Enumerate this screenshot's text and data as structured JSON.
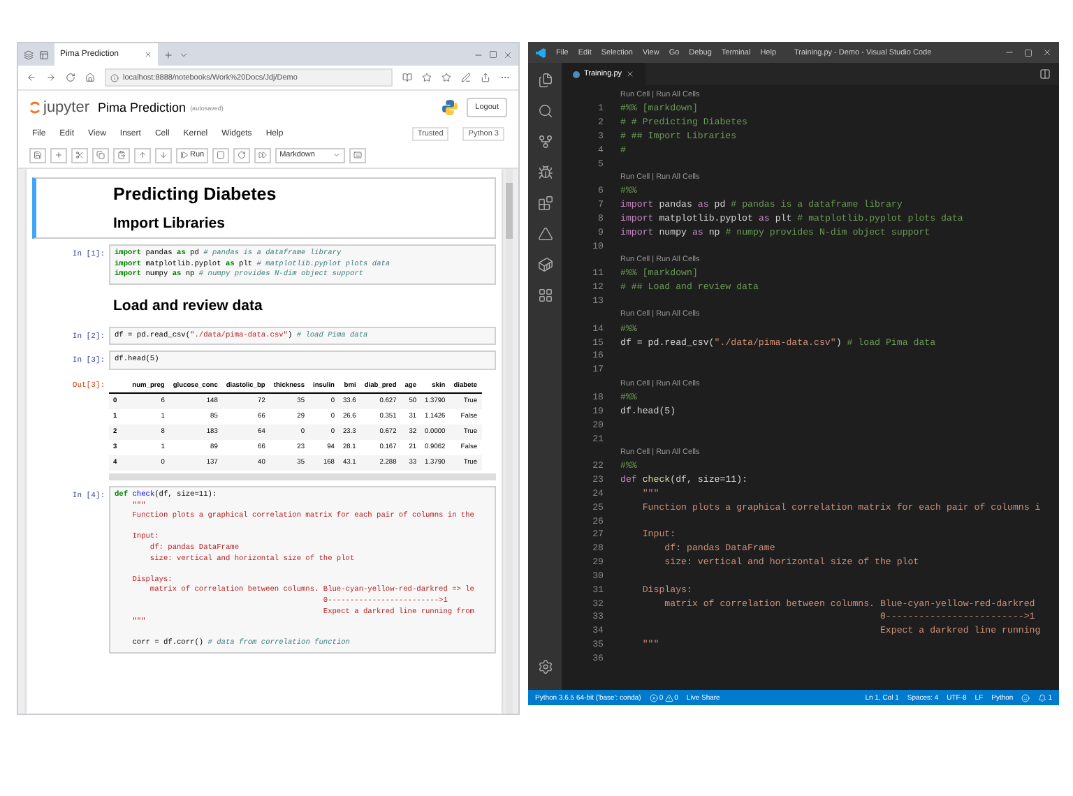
{
  "browser": {
    "tab_title": "Pima Prediction",
    "url": "localhost:8888/notebooks/Work%20Docs/Jdj/Demo"
  },
  "jupyter": {
    "logo_text": "jupyter",
    "notebook_title": "Pima Prediction",
    "save_status": "(autosaved)",
    "logout": "Logout",
    "menu": [
      "File",
      "Edit",
      "View",
      "Insert",
      "Cell",
      "Kernel",
      "Widgets",
      "Help"
    ],
    "trusted": "Trusted",
    "kernel": "Python 3",
    "run_label": "Run",
    "cell_type": "Markdown",
    "cells": [
      {
        "kind": "markdown",
        "selected": true,
        "blocks": [
          {
            "kind": "title",
            "text": "Predicting Diabetes"
          },
          {
            "kind": "heading",
            "text": "Import Libraries"
          }
        ]
      },
      {
        "kind": "code",
        "prompt": "In [1]:",
        "lines": [
          {
            "kind": "code",
            "segments": [
              {
                "kind": "kw",
                "text": "import"
              },
              {
                "kind": "plain",
                "text": " pandas "
              },
              {
                "kind": "kw",
                "text": "as"
              },
              {
                "kind": "plain",
                "text": " pd "
              },
              {
                "kind": "comment",
                "text": "# pandas is a dataframe library"
              }
            ]
          },
          {
            "kind": "code",
            "segments": [
              {
                "kind": "kw",
                "text": "import"
              },
              {
                "kind": "plain",
                "text": " matplotlib.pyplot "
              },
              {
                "kind": "kw",
                "text": "as"
              },
              {
                "kind": "plain",
                "text": " plt "
              },
              {
                "kind": "comment",
                "text": "# matplotlib.pyplot plots data"
              }
            ]
          },
          {
            "kind": "code",
            "segments": [
              {
                "kind": "kw",
                "text": "import"
              },
              {
                "kind": "plain",
                "text": " numpy "
              },
              {
                "kind": "kw",
                "text": "as"
              },
              {
                "kind": "plain",
                "text": " np "
              },
              {
                "kind": "comment",
                "text": "# numpy provides N-dim object support"
              }
            ]
          }
        ]
      },
      {
        "kind": "markdown",
        "selected": false,
        "blocks": [
          {
            "kind": "heading",
            "text": "Load and review data"
          }
        ]
      },
      {
        "kind": "code",
        "prompt": "In [2]:",
        "lines": [
          {
            "kind": "code",
            "segments": [
              {
                "kind": "plain",
                "text": "df = pd.read_csv("
              },
              {
                "kind": "str",
                "text": "\"./data/pima-data.csv\""
              },
              {
                "kind": "plain",
                "text": ") "
              },
              {
                "kind": "comment",
                "text": "# load Pima data"
              }
            ]
          }
        ]
      },
      {
        "kind": "code",
        "prompt": "In [3]:",
        "lines": [
          {
            "kind": "code",
            "segments": [
              {
                "kind": "plain",
                "text": "df.head(5)"
              }
            ]
          }
        ]
      },
      {
        "kind": "output",
        "prompt": "Out[3]:",
        "table": {
          "columns": [
            "",
            "num_preg",
            "glucose_conc",
            "diastolic_bp",
            "thickness",
            "insulin",
            "bmi",
            "diab_pred",
            "age",
            "skin",
            "diabete"
          ],
          "rows": [
            [
              "0",
              "6",
              "148",
              "72",
              "35",
              "0",
              "33.6",
              "0.627",
              "50",
              "1.3790",
              "True"
            ],
            [
              "1",
              "1",
              "85",
              "66",
              "29",
              "0",
              "26.6",
              "0.351",
              "31",
              "1.1426",
              "False"
            ],
            [
              "2",
              "8",
              "183",
              "64",
              "0",
              "0",
              "23.3",
              "0.672",
              "32",
              "0.0000",
              "True"
            ],
            [
              "3",
              "1",
              "89",
              "66",
              "23",
              "94",
              "28.1",
              "0.167",
              "21",
              "0.9062",
              "False"
            ],
            [
              "4",
              "0",
              "137",
              "40",
              "35",
              "168",
              "43.1",
              "2.288",
              "33",
              "1.3790",
              "True"
            ]
          ]
        }
      },
      {
        "kind": "code",
        "prompt": "In [4]:",
        "lines": [
          {
            "kind": "code",
            "segments": [
              {
                "kind": "kw",
                "text": "def"
              },
              {
                "kind": "fn",
                "text": " check"
              },
              {
                "kind": "plain",
                "text": "(df, size=11):"
              }
            ]
          },
          {
            "kind": "code",
            "segments": [
              {
                "kind": "str",
                "text": "    \"\"\""
              }
            ]
          },
          {
            "kind": "code",
            "segments": [
              {
                "kind": "str",
                "text": "    Function plots a graphical correlation matrix for each pair of columns in the"
              }
            ]
          },
          {
            "kind": "blank"
          },
          {
            "kind": "code",
            "segments": [
              {
                "kind": "str",
                "text": "    Input:"
              }
            ]
          },
          {
            "kind": "code",
            "segments": [
              {
                "kind": "str",
                "text": "        df: pandas DataFrame"
              }
            ]
          },
          {
            "kind": "code",
            "segments": [
              {
                "kind": "str",
                "text": "        size: vertical and horizontal size of the plot"
              }
            ]
          },
          {
            "kind": "blank"
          },
          {
            "kind": "code",
            "segments": [
              {
                "kind": "str",
                "text": "    Displays:"
              }
            ]
          },
          {
            "kind": "code",
            "segments": [
              {
                "kind": "str",
                "text": "        matrix of correlation between columns. Blue-cyan-yellow-red-darkred => le"
              }
            ]
          },
          {
            "kind": "code",
            "segments": [
              {
                "kind": "str",
                "text": "                                               0------------------------->1"
              }
            ]
          },
          {
            "kind": "code",
            "segments": [
              {
                "kind": "str",
                "text": "                                               Expect a darkred line running from"
              }
            ]
          },
          {
            "kind": "code",
            "segments": [
              {
                "kind": "str",
                "text": "    \"\"\""
              }
            ]
          },
          {
            "kind": "blank"
          },
          {
            "kind": "code",
            "segments": [
              {
                "kind": "plain",
                "text": "    corr = df.corr() "
              },
              {
                "kind": "comment",
                "text": "# data from correlation function"
              }
            ]
          }
        ]
      }
    ]
  },
  "vscode": {
    "menu": [
      "File",
      "Edit",
      "Selection",
      "View",
      "Go",
      "Debug",
      "Terminal",
      "Help"
    ],
    "title": "Training.py - Demo - Visual Studio Code",
    "tab": "Training.py",
    "rows": [
      {
        "kind": "lens",
        "text": "Run Cell | Run All Cells"
      },
      {
        "kind": "code",
        "number": "1",
        "segments": [
          {
            "kind": "comment",
            "text": "#%% [markdown]"
          }
        ]
      },
      {
        "kind": "code",
        "number": "2",
        "segments": [
          {
            "kind": "comment",
            "text": "# # Predicting Diabetes"
          }
        ]
      },
      {
        "kind": "code",
        "number": "3",
        "segments": [
          {
            "kind": "comment",
            "text": "# ## Import Libraries"
          }
        ]
      },
      {
        "kind": "code",
        "number": "4",
        "segments": [
          {
            "kind": "comment",
            "text": "#"
          }
        ]
      },
      {
        "kind": "code",
        "number": "5",
        "segments": []
      },
      {
        "kind": "lens",
        "text": "Run Cell | Run All Cells"
      },
      {
        "kind": "code",
        "number": "6",
        "segments": [
          {
            "kind": "comment",
            "text": "#%%"
          }
        ]
      },
      {
        "kind": "code",
        "number": "7",
        "segments": [
          {
            "kind": "kw",
            "text": "import"
          },
          {
            "kind": "plain",
            "text": " pandas "
          },
          {
            "kind": "kw",
            "text": "as"
          },
          {
            "kind": "plain",
            "text": " pd "
          },
          {
            "kind": "comment",
            "text": "# pandas is a dataframe library"
          }
        ]
      },
      {
        "kind": "code",
        "number": "8",
        "segments": [
          {
            "kind": "kw",
            "text": "import"
          },
          {
            "kind": "plain",
            "text": " matplotlib.pyplot "
          },
          {
            "kind": "kw",
            "text": "as"
          },
          {
            "kind": "plain",
            "text": " plt "
          },
          {
            "kind": "comment",
            "text": "# matplotlib.pyplot plots data"
          }
        ]
      },
      {
        "kind": "code",
        "number": "9",
        "segments": [
          {
            "kind": "kw",
            "text": "import"
          },
          {
            "kind": "plain",
            "text": " numpy "
          },
          {
            "kind": "kw",
            "text": "as"
          },
          {
            "kind": "plain",
            "text": " np "
          },
          {
            "kind": "comment",
            "text": "# numpy provides N-dim object support"
          }
        ]
      },
      {
        "kind": "code",
        "number": "10",
        "segments": []
      },
      {
        "kind": "lens",
        "text": "Run Cell | Run All Cells"
      },
      {
        "kind": "code",
        "number": "11",
        "segments": [
          {
            "kind": "comment",
            "text": "#%% [markdown]"
          }
        ]
      },
      {
        "kind": "code",
        "number": "12",
        "segments": [
          {
            "kind": "comment",
            "text": "# ## Load and review data"
          }
        ]
      },
      {
        "kind": "code",
        "number": "13",
        "segments": []
      },
      {
        "kind": "lens",
        "text": "Run Cell | Run All Cells"
      },
      {
        "kind": "code",
        "number": "14",
        "segments": [
          {
            "kind": "comment",
            "text": "#%%"
          }
        ]
      },
      {
        "kind": "code",
        "number": "15",
        "segments": [
          {
            "kind": "plain",
            "text": "df = pd.read_csv("
          },
          {
            "kind": "str",
            "text": "\"./data/pima-data.csv\""
          },
          {
            "kind": "plain",
            "text": ") "
          },
          {
            "kind": "comment",
            "text": "# load Pima data"
          }
        ]
      },
      {
        "kind": "code",
        "number": "16",
        "segments": []
      },
      {
        "kind": "code",
        "number": "17",
        "segments": []
      },
      {
        "kind": "lens",
        "text": "Run Cell | Run All Cells"
      },
      {
        "kind": "code",
        "number": "18",
        "segments": [
          {
            "kind": "comment",
            "text": "#%%"
          }
        ]
      },
      {
        "kind": "code",
        "number": "19",
        "segments": [
          {
            "kind": "plain",
            "text": "df.head(5)"
          }
        ]
      },
      {
        "kind": "code",
        "number": "20",
        "segments": []
      },
      {
        "kind": "code",
        "number": "21",
        "segments": []
      },
      {
        "kind": "lens",
        "text": "Run Cell | Run All Cells"
      },
      {
        "kind": "code",
        "number": "22",
        "segments": [
          {
            "kind": "comment",
            "text": "#%%"
          }
        ]
      },
      {
        "kind": "code",
        "number": "23",
        "segments": [
          {
            "kind": "kw",
            "text": "def"
          },
          {
            "kind": "fn",
            "text": " check"
          },
          {
            "kind": "plain",
            "text": "(df, size=11):"
          }
        ]
      },
      {
        "kind": "code",
        "number": "24",
        "segments": [
          {
            "kind": "str",
            "text": "    \"\"\""
          }
        ]
      },
      {
        "kind": "code",
        "number": "25",
        "segments": [
          {
            "kind": "str",
            "text": "    Function plots a graphical correlation matrix for each pair of columns i"
          }
        ]
      },
      {
        "kind": "code",
        "number": "26",
        "segments": []
      },
      {
        "kind": "code",
        "number": "27",
        "segments": [
          {
            "kind": "str",
            "text": "    Input:"
          }
        ]
      },
      {
        "kind": "code",
        "number": "28",
        "segments": [
          {
            "kind": "str",
            "text": "        df: pandas DataFrame"
          }
        ]
      },
      {
        "kind": "code",
        "number": "29",
        "segments": [
          {
            "kind": "str",
            "text": "        size: vertical and horizontal size of the plot"
          }
        ]
      },
      {
        "kind": "code",
        "number": "30",
        "segments": []
      },
      {
        "kind": "code",
        "number": "31",
        "segments": [
          {
            "kind": "str",
            "text": "    Displays:"
          }
        ]
      },
      {
        "kind": "code",
        "number": "32",
        "segments": [
          {
            "kind": "str",
            "text": "        matrix of correlation between columns. Blue-cyan-yellow-red-darkred"
          }
        ]
      },
      {
        "kind": "code",
        "number": "33",
        "segments": [
          {
            "kind": "str",
            "text": "                                               0------------------------->1"
          }
        ]
      },
      {
        "kind": "code",
        "number": "34",
        "segments": [
          {
            "kind": "str",
            "text": "                                               Expect a darkred line running"
          }
        ]
      },
      {
        "kind": "code",
        "number": "35",
        "segments": [
          {
            "kind": "str",
            "text": "    \"\"\""
          }
        ]
      },
      {
        "kind": "code",
        "number": "36",
        "segments": []
      }
    ],
    "status": {
      "interpreter": "Python 3.6.5 64-bit ('base': conda)",
      "errors": "0",
      "warnings": "0",
      "live_share": "Live Share",
      "position": "Ln 1, Col 1",
      "spaces": "Spaces: 4",
      "encoding": "UTF-8",
      "eol": "LF",
      "language": "Python",
      "notifications": "1"
    }
  }
}
